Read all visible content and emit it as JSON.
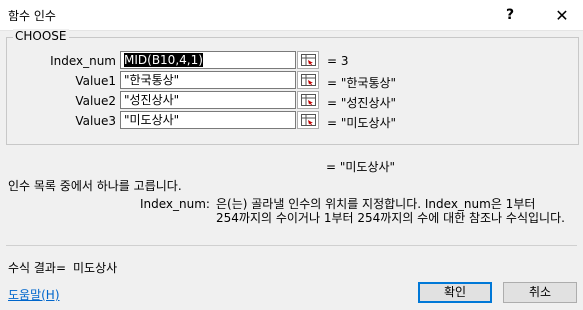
{
  "window": {
    "title": "함수 인수",
    "help_glyph": "?",
    "close_glyph": "✕"
  },
  "function_group": {
    "name": "CHOOSE",
    "arguments": [
      {
        "label": "Index_num",
        "input": "MID(B10,4,1)",
        "result": "=  3"
      },
      {
        "label": "Value1",
        "input": "\"한국통상\"",
        "result": "=  \"한국통상\""
      },
      {
        "label": "Value2",
        "input": "\"성진상사\"",
        "result": "=  \"성진상사\""
      },
      {
        "label": "Value3",
        "input": "\"미도상사\"",
        "result": "=  \"미도상사\""
      }
    ]
  },
  "final_value": "=  \"미도상사\"",
  "description": "인수 목록 중에서 하나를 고릅니다.",
  "argument_help": {
    "name": "Index_num:",
    "line1": "은(는) 골라낼 인수의 위치를 지정합니다. Index_num은 1부터",
    "line2": "254까지의 수이거나 1부터 254까지의 수에 대한 참조나 수식입니다."
  },
  "formula_result": {
    "label": "수식 결과=",
    "value": "미도상사"
  },
  "help_link": "도움말(H)",
  "buttons": {
    "ok": "확인",
    "cancel": "취소"
  },
  "colors": {
    "dialog_bg": "#f0f0f0",
    "default_button_border": "#0078d7",
    "link": "#0066cc"
  }
}
